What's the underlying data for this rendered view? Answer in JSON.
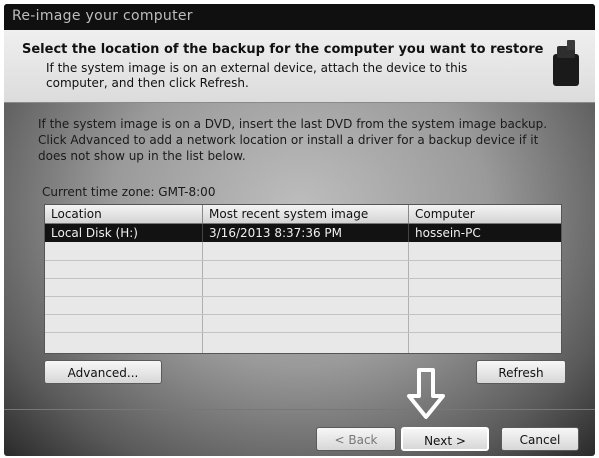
{
  "window": {
    "title": "Re-image your computer"
  },
  "header": {
    "title": "Select the location of the backup for the computer you want to restore",
    "subtitle": "If the system image is on an external device, attach the device to this computer, and then click Refresh."
  },
  "instructions": "If the system image is on a DVD, insert the last DVD from the system image backup. Click Advanced to add a network location or install a driver for a backup device if it does not show up in the list below.",
  "timezone": "Current time zone: GMT-8:00",
  "table": {
    "columns": [
      "Location",
      "Most recent system image",
      "Computer"
    ],
    "rows": [
      {
        "location": "Local Disk (H:)",
        "image": "3/16/2013 8:37:36 PM",
        "computer": "hossein-PC"
      }
    ]
  },
  "buttons": {
    "advanced": "Advanced...",
    "refresh": "Refresh",
    "back": "< Back",
    "next": "Next >",
    "cancel": "Cancel"
  },
  "icons": {
    "header": "backup-drive-icon",
    "annotation": "down-arrow-icon"
  }
}
